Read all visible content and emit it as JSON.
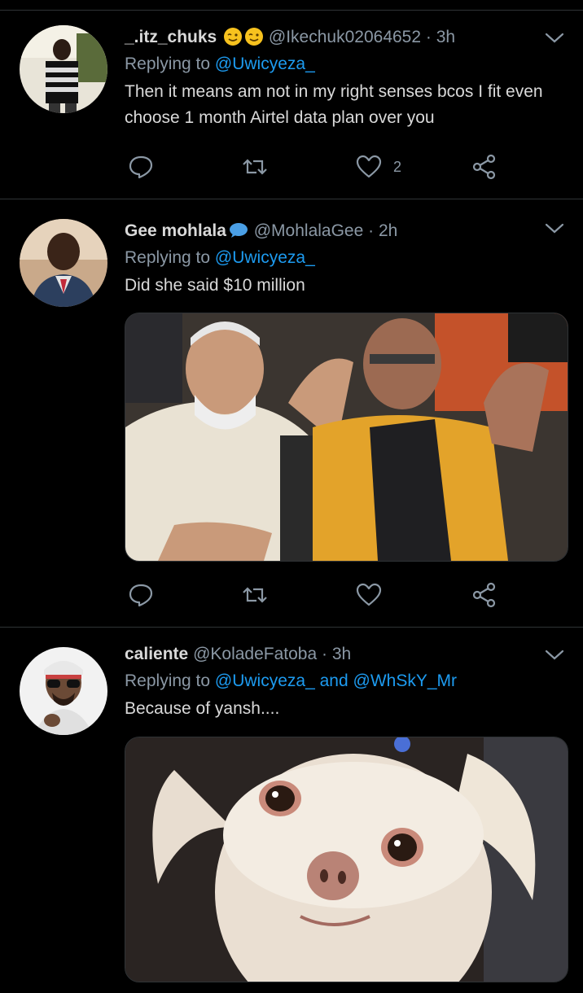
{
  "colors": {
    "background": "#000000",
    "link": "#1d9bf0",
    "muted": "#8b98a5",
    "text": "#d9d9d9",
    "divider": "#2f3336"
  },
  "tweets": [
    {
      "display_name": "_.itz_chuks",
      "handle": "@Ikechuk02064652",
      "separator": "·",
      "time": "3h",
      "replying_prefix": "Replying to",
      "replying_to": "@Uwicyeza_",
      "replying_and": "",
      "replying_to_2": "",
      "text": "Then it means am not in my right senses bcos I fit even choose 1 month Airtel data plan over you",
      "like_count": "2",
      "icons": [
        "reply-icon",
        "retweet-icon",
        "heart-icon",
        "share-icon"
      ]
    },
    {
      "display_name": "Gee mohlala",
      "handle": "@MohlalaGee",
      "separator": "·",
      "time": "2h",
      "replying_prefix": "Replying to",
      "replying_to": "@Uwicyeza_",
      "text": "Did she said $10 million",
      "like_count": "",
      "media": "photo",
      "icons": [
        "reply-icon",
        "retweet-icon",
        "heart-icon",
        "share-icon"
      ]
    },
    {
      "display_name": "caliente",
      "handle": "@KoladeFatoba",
      "separator": "·",
      "time": "3h",
      "replying_prefix": "Replying to",
      "replying_to": "@Uwicyeza_",
      "replying_and": "and",
      "replying_to_2": "@WhSkY_Mr",
      "text": "Because of yansh....",
      "media": "photo"
    }
  ]
}
